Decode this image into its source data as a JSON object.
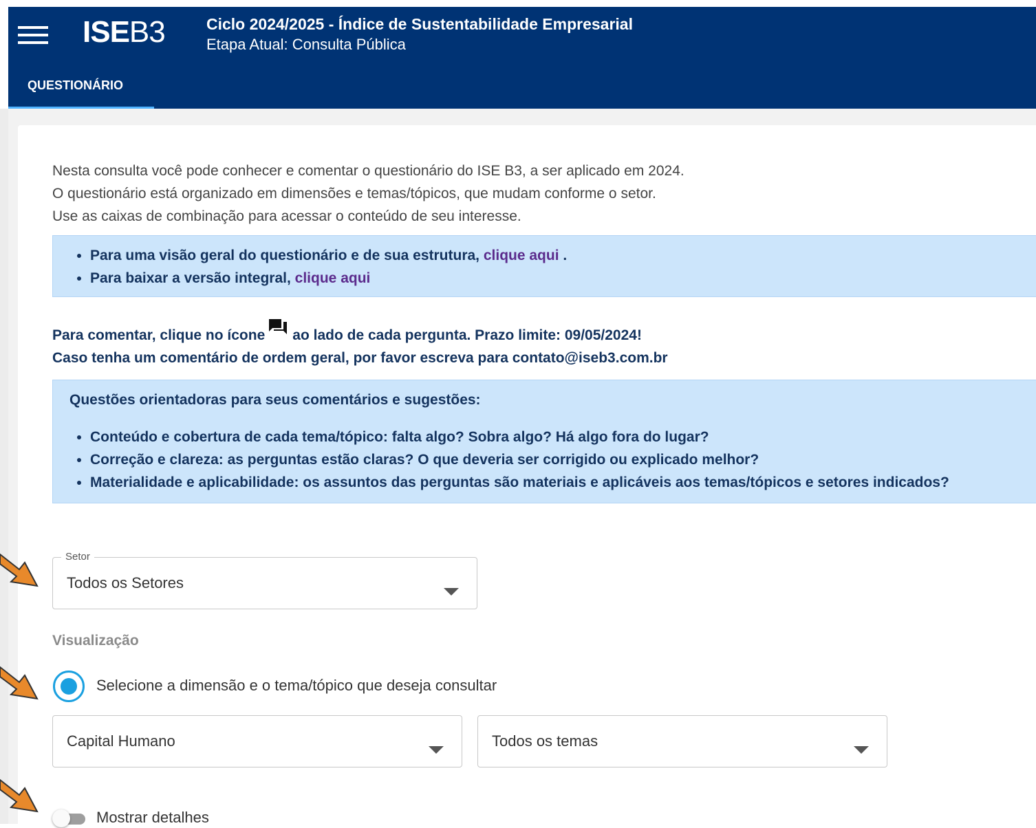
{
  "header": {
    "logo_bold": "ISE",
    "logo_light": "B3",
    "cycle_title": "Ciclo 2024/2025 - Índice de Sustentabilidade Empresarial",
    "stage": "Etapa Atual: Consulta Pública",
    "tab_label": "QUESTIONÁRIO"
  },
  "intro": {
    "line1": "Nesta consulta você pode conhecer e comentar o questionário do ISE B3, a ser aplicado em 2024.",
    "line2": "O questionário está organizado em dimensões e temas/tópicos, que mudam conforme o setor.",
    "line3": "Use as caixas de combinação para acessar o conteúdo de seu interesse."
  },
  "info_box": {
    "item1_text": "Para uma visão geral do questionário e de sua estrutura, ",
    "item1_link": "clique aqui",
    "item1_suffix": " .",
    "item2_text": "Para baixar a versão integral, ",
    "item2_link": "clique aqui"
  },
  "comment": {
    "line1_prefix": "Para comentar, clique no ícone",
    "line1_suffix": "ao lado de cada pergunta. Prazo limite: 09/05/2024!",
    "line2": "Caso tenha um comentário de ordem geral, por favor escreva para contato@iseb3.com.br"
  },
  "guide_box": {
    "heading": "Questões orientadoras para seus comentários e sugestões:",
    "items": [
      "Conteúdo e cobertura de cada tema/tópico: falta algo? Sobra algo? Há algo fora do lugar?",
      "Correção e clareza: as perguntas estão claras? O que deveria ser corrigido ou explicado melhor?",
      "Materialidade e aplicabilidade: os assuntos das perguntas são materiais e aplicáveis aos temas/tópicos e setores indicados?"
    ]
  },
  "sector_select": {
    "legend": "Setor",
    "value": "Todos os Setores"
  },
  "visualization": {
    "label": "Visualização",
    "radio_label": "Selecione a dimensão e o tema/tópico que deseja consultar",
    "radio_selected": true
  },
  "dimension_select": {
    "value": "Capital Humano"
  },
  "theme_select": {
    "value": "Todos os temas"
  },
  "details_toggle": {
    "label": "Mostrar detalhes",
    "on": false
  },
  "colors": {
    "header_bg": "#003374",
    "info_bg": "#cce5fb",
    "link": "#5b2b8c",
    "radio": "#1aa0e0",
    "arrow": "#e8892b"
  },
  "icons": {
    "menu": "hamburger-icon",
    "comment": "chat-bubbles-icon",
    "dropdown": "caret-down-icon",
    "annotation": "arrow-pointer-icon"
  }
}
